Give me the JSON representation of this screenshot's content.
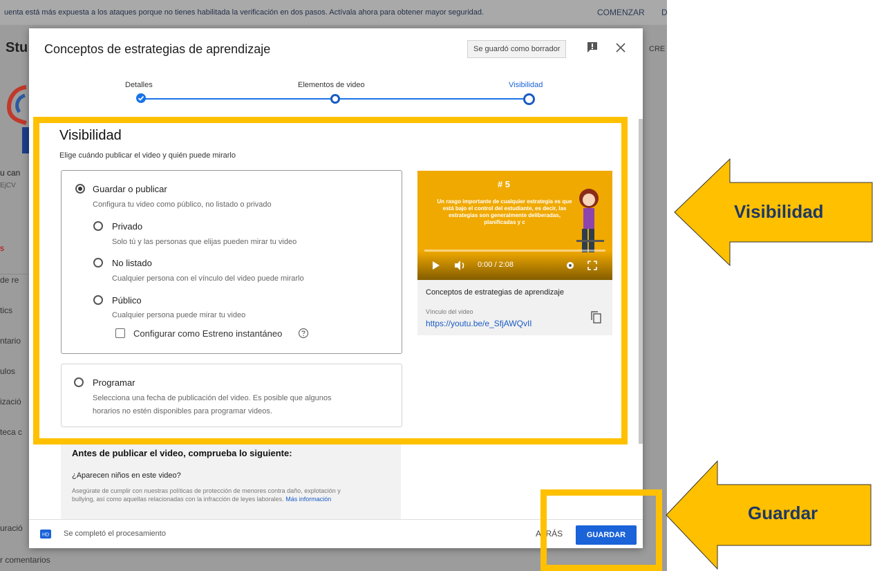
{
  "banner": {
    "message": "uenta está más expuesta a los ataques porque no tienes habilitada la verificación en dos pasos. Actívala ahora para obtener mayor seguridad.",
    "action": "COMENZAR",
    "overflow_char": "D"
  },
  "background": {
    "studio_fragment": "Stu",
    "create_fragment": "CRE",
    "sidebar": [
      {
        "text": "u can"
      },
      {
        "text": "EjCV"
      },
      {
        "text": "s"
      },
      {
        "text": "de re"
      },
      {
        "text": "tics"
      },
      {
        "text": "ntario"
      },
      {
        "text": "ulos"
      },
      {
        "text": "izació"
      },
      {
        "text": "teca c"
      },
      {
        "text": "uració"
      },
      {
        "text": "r comentarios"
      }
    ]
  },
  "modal": {
    "title": "Conceptos de estrategias de aprendizaje",
    "draft_status": "Se guardó como borrador",
    "steps": [
      {
        "label": "Detalles",
        "state": "done"
      },
      {
        "label": "Elementos de video",
        "state": "done"
      },
      {
        "label": "Visibilidad",
        "state": "current"
      }
    ],
    "visibility": {
      "heading": "Visibilidad",
      "subheading": "Elige cuándo publicar el video y quién puede mirarlo",
      "save_publish": {
        "label": "Guardar o publicar",
        "description": "Configura tu video como público, no listado o privado"
      },
      "options": [
        {
          "label": "Privado",
          "description": "Solo tú y las personas que elijas pueden mirar tu video"
        },
        {
          "label": "No listado",
          "description": "Cualquier persona con el vínculo del video puede mirarlo"
        },
        {
          "label": "Público",
          "description": "Cualquier persona puede mirar tu video"
        }
      ],
      "premiere_checkbox": "Configurar como Estreno instantáneo",
      "schedule": {
        "label": "Programar",
        "description_line1": "Selecciona una fecha de publicación del video. Es posible que algunos",
        "description_line2": "horarios no estén disponibles para programar videos."
      }
    },
    "preview": {
      "video_number": "# 5",
      "video_text": "Un rasgo importante de cualquier estrategia es que está bajo el control del estudiante, es decir, las estrategias son generalmente deliberadas, planificadas y c",
      "time": "0:00 / 2:08",
      "title": "Conceptos de estrategias de aprendizaje",
      "link_label": "Vínculo del video",
      "link": "https://youtu.be/e_SfjAWQvII"
    },
    "checklist": {
      "title": "Antes de publicar el video, comprueba lo siguiente:",
      "question": "¿Aparecen niños en este video?",
      "body": "Asegúrate de cumplir con nuestras políticas de protección de menores contra daño, explotación y bullying, así como aquellas relacionadas con la infracción de leyes laborales.",
      "more_link": "Más información"
    },
    "footer": {
      "processing": "Se completó el procesamiento",
      "back": "ATRÁS",
      "save": "GUARDAR"
    }
  },
  "annotations": {
    "visibility_callout": "Visibilidad",
    "save_callout": "Guardar",
    "highlight_color": "#ffc000",
    "text_color": "#1f3864"
  }
}
